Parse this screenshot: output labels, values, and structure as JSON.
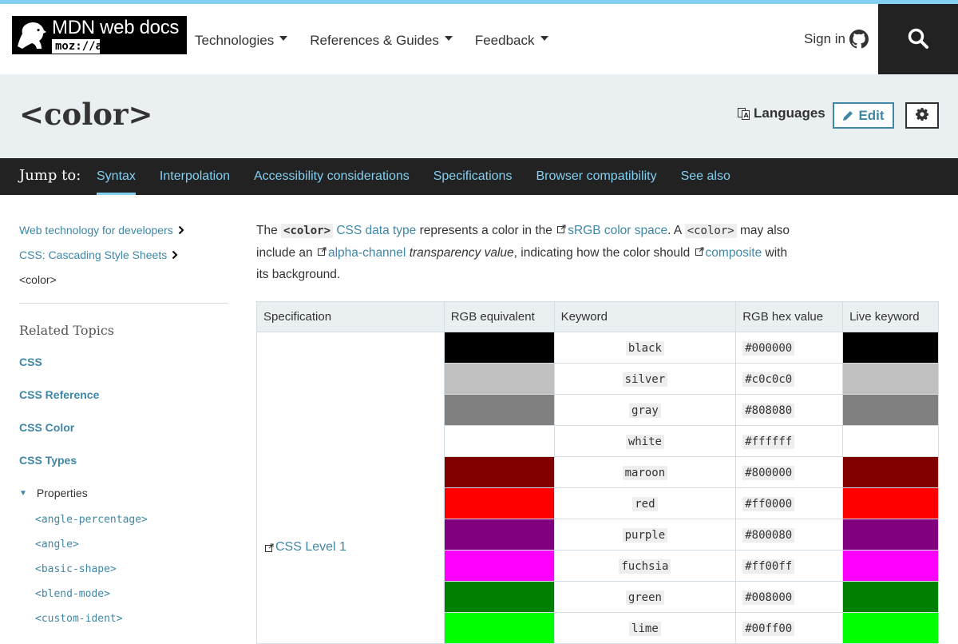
{
  "header": {
    "logo_name": "MDN web docs",
    "logo_mozilla": "moz://a",
    "nav": [
      {
        "label": "Technologies"
      },
      {
        "label": "References & Guides"
      },
      {
        "label": "Feedback"
      }
    ],
    "signin_label": "Sign in",
    "accent_color": "#83d0f2"
  },
  "titlebar": {
    "title": "<color>",
    "languages_label": "Languages",
    "edit_label": "Edit"
  },
  "jump": {
    "label": "Jump to:",
    "links": [
      {
        "label": "Syntax",
        "active": true
      },
      {
        "label": "Interpolation"
      },
      {
        "label": "Accessibility considerations"
      },
      {
        "label": "Specifications"
      },
      {
        "label": "Browser compatibility"
      },
      {
        "label": "See also"
      }
    ]
  },
  "sidebar": {
    "breadcrumbs": [
      {
        "label": "Web technology for developers"
      },
      {
        "label": "CSS: Cascading Style Sheets"
      },
      {
        "label": "<color>"
      }
    ],
    "related_title": "Related Topics",
    "topics": [
      "CSS",
      "CSS Reference",
      "CSS Color",
      "CSS Types"
    ],
    "properties_label": "Properties",
    "properties": [
      "<angle-percentage>",
      "<angle>",
      "<basic-shape>",
      "<blend-mode>",
      "<custom-ident>"
    ]
  },
  "intro": {
    "t1": "The ",
    "code1": "<color>",
    "link1": "CSS data type",
    "t2": " represents a color in the ",
    "link2": "sRGB color space",
    "t3": ". A ",
    "code2": "<color>",
    "t4": " may also include an ",
    "link3": "alpha-channel",
    "t5": " ",
    "em1": "transparency value",
    "t6": ", indicating how the color should ",
    "link4": "composite",
    "t7": " with its background."
  },
  "table": {
    "headers": [
      "Specification",
      "RGB equivalent",
      "Keyword",
      "RGB hex value",
      "Live keyword"
    ],
    "spec": "CSS Level 1",
    "rows": [
      {
        "keyword": "black",
        "hex": "#000000"
      },
      {
        "keyword": "silver",
        "hex": "#c0c0c0"
      },
      {
        "keyword": "gray",
        "hex": "#808080"
      },
      {
        "keyword": "white",
        "hex": "#ffffff"
      },
      {
        "keyword": "maroon",
        "hex": "#800000"
      },
      {
        "keyword": "red",
        "hex": "#ff0000"
      },
      {
        "keyword": "purple",
        "hex": "#800080"
      },
      {
        "keyword": "fuchsia",
        "hex": "#ff00ff"
      },
      {
        "keyword": "green",
        "hex": "#008000"
      },
      {
        "keyword": "lime",
        "hex": "#00ff00"
      }
    ]
  }
}
